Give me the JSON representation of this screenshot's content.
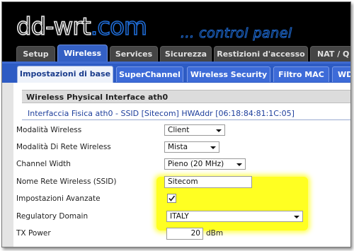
{
  "logo": {
    "part1": "dd-wrt",
    "part2": ".com",
    "tagline": "... control panel"
  },
  "main_tabs": [
    {
      "label": "Setup",
      "active": false
    },
    {
      "label": "Wireless",
      "active": true
    },
    {
      "label": "Services",
      "active": false
    },
    {
      "label": "Sicurezza",
      "active": false
    },
    {
      "label": "Restizioni d'accesso",
      "active": false
    },
    {
      "label": "NAT / Q",
      "active": false
    }
  ],
  "sub_tabs": [
    {
      "label": "Impostazioni di base",
      "active": true
    },
    {
      "label": "SuperChannel",
      "active": false
    },
    {
      "label": "Wireless Security",
      "active": false
    },
    {
      "label": "Filtro MAC",
      "active": false
    },
    {
      "label": "WD",
      "active": false
    }
  ],
  "section": {
    "title": "Wireless Physical Interface ath0",
    "legend": "Interfaccia Fisica ath0 - SSID [Sitecom] HWAddr [06:18:84:81:1C:05]"
  },
  "fields": {
    "wireless_mode": {
      "label": "Modalità Wireless",
      "value": "Client"
    },
    "network_mode": {
      "label": "Modalità Di Rete Wireless",
      "value": "Mista"
    },
    "channel_width": {
      "label": "Channel Width",
      "value": "Pieno (20 MHz)"
    },
    "ssid": {
      "label": "Nome Rete Wireless (SSID)",
      "value": "Sitecom"
    },
    "advanced": {
      "label": "Impostazioni Avanzate",
      "checked": true
    },
    "regulatory_domain": {
      "label": "Regulatory Domain",
      "value": "ITALY"
    },
    "tx_power": {
      "label": "TX Power",
      "value": "20",
      "unit": "dBm"
    }
  },
  "colors": {
    "highlight": "#ffff22",
    "accent": "#2d5bc4",
    "active_tab": "#3460c4"
  }
}
